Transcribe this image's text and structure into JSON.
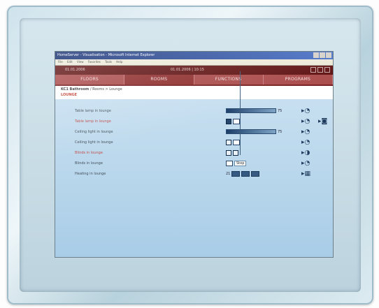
{
  "window": {
    "title": "HomeServer - Visualisation - Microsoft Internet Explorer",
    "menu": [
      "File",
      "Edit",
      "View",
      "Favorites",
      "Tools",
      "Help"
    ]
  },
  "status": {
    "date": "01.01.2006",
    "clock": "01.01.2006 | 10:15"
  },
  "tabs": [
    {
      "label": "FLOORS",
      "active": false
    },
    {
      "label": "ROOMS",
      "active": true
    },
    {
      "label": "FUNCTIONS",
      "active": false
    },
    {
      "label": "PROGRAMS",
      "active": false
    }
  ],
  "breadcrumb": {
    "path": "KC1 Bathroom / Rooms > Lounge",
    "bold": "KC1 Bathroom",
    "rest": " / Rooms > Lounge",
    "subtitle": "LOUNGE"
  },
  "rows": [
    {
      "label": "Table lamp in lounge",
      "highlight": false,
      "control": "slider",
      "value": "75"
    },
    {
      "label": "Table lamp in lounge",
      "highlight": true,
      "control": "switch"
    },
    {
      "label": "Ceiling light in lounge",
      "highlight": false,
      "control": "slider",
      "value": "75"
    },
    {
      "label": "Ceiling light in lounge",
      "highlight": false,
      "control": "switch"
    },
    {
      "label": "Blinds in lounge",
      "highlight": true,
      "control": "updown"
    },
    {
      "label": "Blinds in lounge",
      "highlight": false,
      "control": "text",
      "value": "Stop"
    },
    {
      "label": "Heating in lounge",
      "highlight": false,
      "control": "heating",
      "value": "21"
    }
  ],
  "colors": {
    "accent": "#a94a4a",
    "statusbar": "#5e1010",
    "panel": "#b8d6ec"
  }
}
